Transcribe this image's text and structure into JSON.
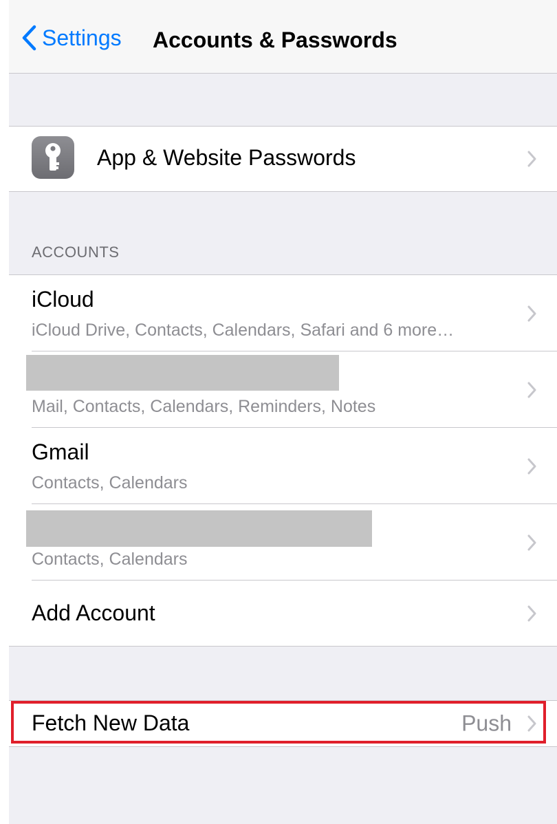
{
  "navbar": {
    "back_label": "Settings",
    "title": "Accounts & Passwords"
  },
  "passwords_row": {
    "label": "App & Website Passwords",
    "icon": "key-icon"
  },
  "accounts_section": {
    "header": "ACCOUNTS",
    "items": [
      {
        "title": "iCloud",
        "subtitle": "iCloud Drive, Contacts, Calendars, Safari and 6 more…",
        "redacted": false
      },
      {
        "title": "",
        "subtitle": "Mail, Contacts, Calendars, Reminders, Notes",
        "redacted": true
      },
      {
        "title": "Gmail",
        "subtitle": "Contacts, Calendars",
        "redacted": false
      },
      {
        "title": "",
        "subtitle": "Contacts, Calendars",
        "redacted": true
      }
    ],
    "add_account_label": "Add Account"
  },
  "fetch_row": {
    "label": "Fetch New Data",
    "value": "Push"
  },
  "colors": {
    "accent": "#007aff",
    "highlight": "#e01f2b",
    "background": "#efeff4"
  }
}
